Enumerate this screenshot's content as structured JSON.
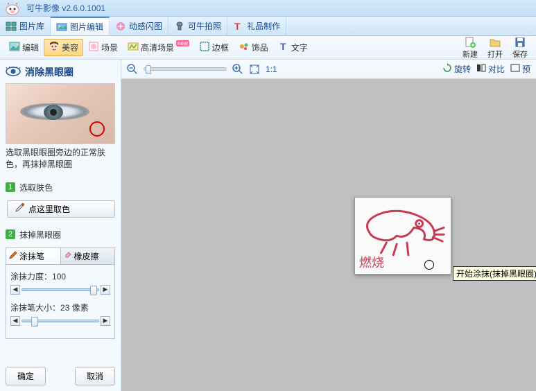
{
  "app": {
    "title": "可牛影像  v2.6.0.1001"
  },
  "main_tabs": [
    {
      "label": "图片库",
      "icon": "gallery-icon"
    },
    {
      "label": "图片编辑",
      "icon": "edit-icon",
      "active": true
    },
    {
      "label": "动感闪图",
      "icon": "flash-icon"
    },
    {
      "label": "可牛拍照",
      "icon": "camera-icon"
    },
    {
      "label": "礼品制作",
      "icon": "gift-icon"
    }
  ],
  "toolbar": {
    "items": [
      {
        "label": "编辑",
        "icon": "landscape-icon"
      },
      {
        "label": "美容",
        "icon": "face-icon",
        "active": true
      },
      {
        "label": "场景",
        "icon": "scene-icon"
      },
      {
        "label": "高清场景",
        "icon": "hd-scene-icon",
        "badge": "new"
      },
      {
        "label": "边框",
        "icon": "frame-icon"
      },
      {
        "label": "饰品",
        "icon": "ornament-icon"
      },
      {
        "label": "文字",
        "icon": "text-icon"
      }
    ],
    "right": [
      {
        "label": "新建",
        "icon": "new-file-icon"
      },
      {
        "label": "打开",
        "icon": "open-icon"
      },
      {
        "label": "保存",
        "icon": "save-icon"
      }
    ]
  },
  "sidebar": {
    "title": "消除黑眼圈",
    "hint": "选取黑眼眼圈旁边的正常肤色，再抹掉黑眼圈",
    "steps": [
      {
        "num": "1",
        "label": "选取肤色"
      },
      {
        "num": "2",
        "label": "抹掉黑眼圈"
      }
    ],
    "pick_button": "点这里取色",
    "tool_tabs": [
      {
        "label": "涂抹笔",
        "icon": "brush-icon",
        "active": true
      },
      {
        "label": "橡皮擦",
        "icon": "eraser-icon"
      }
    ],
    "strength_label": "涂抹力度：",
    "strength_value": "100",
    "brush_label": "涂抹笔大小：",
    "brush_value": "23",
    "brush_unit": " 像素",
    "ok": "确定",
    "cancel": "取消"
  },
  "canvas_tools": {
    "ratio": "1:1",
    "rotate": "旋转",
    "compare": "对比",
    "preview": "预"
  },
  "canvas": {
    "burn_text": "燃烧",
    "tooltip": "开始涂抹(抹掉黑眼圈)"
  }
}
